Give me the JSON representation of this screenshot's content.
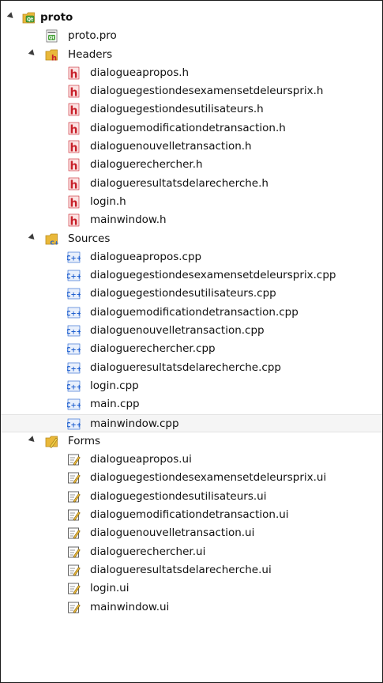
{
  "project": {
    "name": "proto",
    "icon": "qt-project-icon",
    "pro_file": "proto.pro"
  },
  "groups": {
    "headers": {
      "label": "Headers",
      "icon": "headers-folder-icon",
      "files": [
        "dialogueapropos.h",
        "dialoguegestiondesexamensetdeleursprix.h",
        "dialoguegestiondesutilisateurs.h",
        "dialoguemodificationdetransaction.h",
        "dialoguenouvelletransaction.h",
        "dialoguerechercher.h",
        "dialogueresultatsdelarecherche.h",
        "login.h",
        "mainwindow.h"
      ]
    },
    "sources": {
      "label": "Sources",
      "icon": "sources-folder-icon",
      "files": [
        "dialogueapropos.cpp",
        "dialoguegestiondesexamensetdeleursprix.cpp",
        "dialoguegestiondesutilisateurs.cpp",
        "dialoguemodificationdetransaction.cpp",
        "dialoguenouvelletransaction.cpp",
        "dialoguerechercher.cpp",
        "dialogueresultatsdelarecherche.cpp",
        "login.cpp",
        "main.cpp",
        "mainwindow.cpp"
      ],
      "selected_file": "mainwindow.cpp"
    },
    "forms": {
      "label": "Forms",
      "icon": "forms-folder-icon",
      "files": [
        "dialogueapropos.ui",
        "dialoguegestiondesexamensetdeleursprix.ui",
        "dialoguegestiondesutilisateurs.ui",
        "dialoguemodificationdetransaction.ui",
        "dialoguenouvelletransaction.ui",
        "dialoguerechercher.ui",
        "dialogueresultatsdelarecherche.ui",
        "login.ui",
        "mainwindow.ui"
      ]
    }
  },
  "colors": {
    "folder_yellow": "#e9b83a",
    "header_file_red": "#c8202a",
    "cpp_file_blue": "#1f5fcf",
    "selection_bg": "#f5f5f5"
  }
}
